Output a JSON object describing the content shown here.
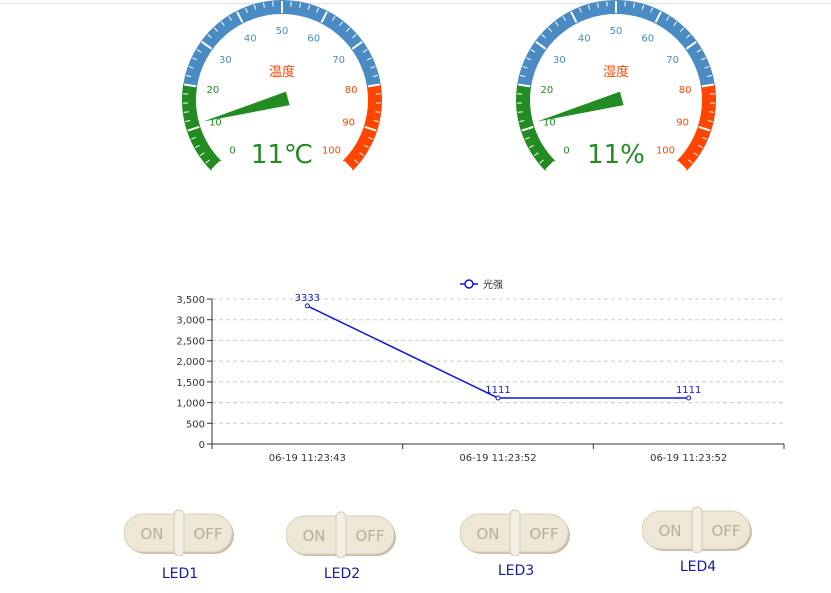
{
  "gauges": [
    {
      "title": "温度",
      "value": 11,
      "value_text": "11℃",
      "min": 0,
      "max": 100,
      "tick_labels": [
        "0",
        "10",
        "20",
        "30",
        "40",
        "50",
        "60",
        "70",
        "80",
        "90",
        "100"
      ],
      "band_colors": {
        "low": "#228b22",
        "mid": "#4b8bc4",
        "high": "#ff4500"
      },
      "bands": [
        [
          0,
          0.2
        ],
        [
          0.2,
          0.8
        ],
        [
          0.8,
          1.0
        ]
      ],
      "title_color": "#ff4500",
      "value_color": "#228b22",
      "pointer_color": "#228b22"
    },
    {
      "title": "湿度",
      "value": 11,
      "value_text": "11%",
      "min": 0,
      "max": 100,
      "tick_labels": [
        "0",
        "10",
        "20",
        "30",
        "40",
        "50",
        "60",
        "70",
        "80",
        "90",
        "100"
      ],
      "band_colors": {
        "low": "#228b22",
        "mid": "#4b8bc4",
        "high": "#ff4500"
      },
      "bands": [
        [
          0,
          0.2
        ],
        [
          0.2,
          0.8
        ],
        [
          0.8,
          1.0
        ]
      ],
      "title_color": "#ff4500",
      "value_color": "#228b22",
      "pointer_color": "#228b22"
    }
  ],
  "chart_data": {
    "type": "line",
    "title": "",
    "xlabel": "",
    "ylabel": "",
    "categories": [
      "06-19 11:23:43",
      "06-19 11:23:52",
      "06-19 11:23:52"
    ],
    "series": [
      {
        "name": "光强",
        "values": [
          3333,
          1111,
          1111
        ],
        "color": "#1414d9"
      }
    ],
    "ylim": [
      0,
      3500
    ],
    "yticks": [
      0,
      500,
      1000,
      1500,
      2000,
      2500,
      3000,
      3500
    ],
    "ytick_labels": [
      "0",
      "500",
      "1,000",
      "1,500",
      "2,000",
      "2,500",
      "3,000",
      "3,500"
    ],
    "grid": true,
    "legend": "top-center",
    "data_labels": true
  },
  "leds": [
    {
      "label": "LED1",
      "on_text": "ON",
      "off_text": "OFF"
    },
    {
      "label": "LED2",
      "on_text": "ON",
      "off_text": "OFF"
    },
    {
      "label": "LED3",
      "on_text": "ON",
      "off_text": "OFF"
    },
    {
      "label": "LED4",
      "on_text": "ON",
      "off_text": "OFF"
    }
  ]
}
